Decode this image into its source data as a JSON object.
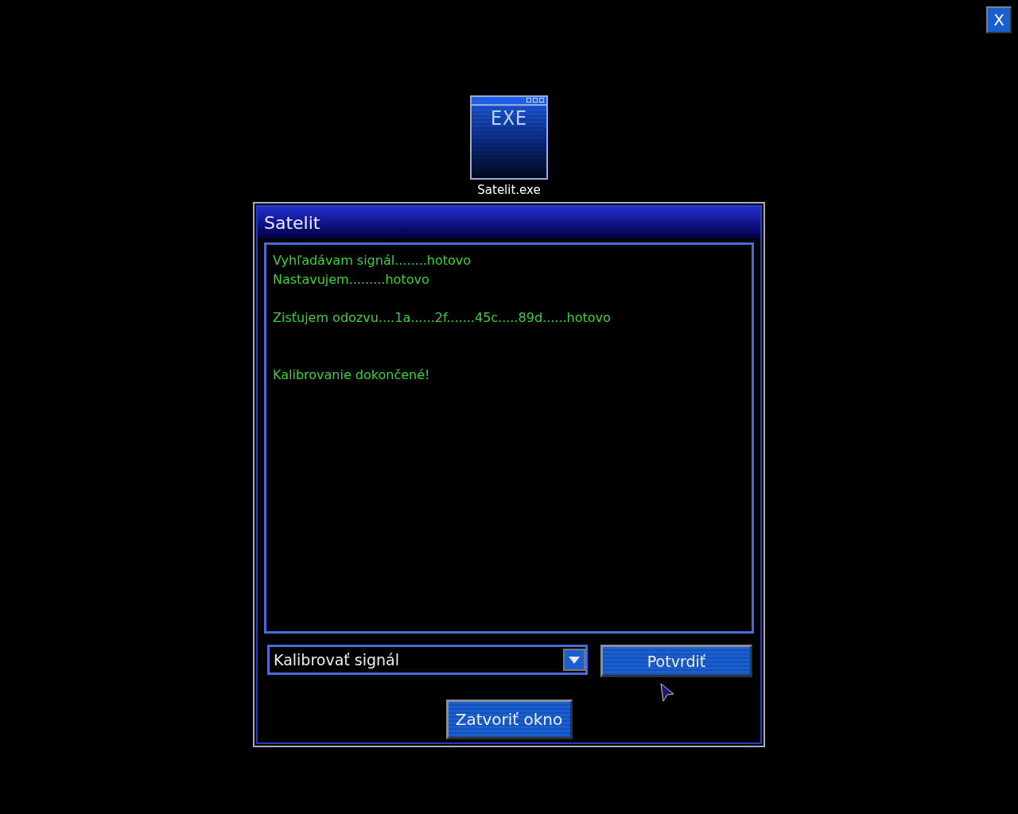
{
  "screen_close": {
    "label": "X"
  },
  "desktop_icon": {
    "badge": "EXE",
    "label": "Satelit.exe"
  },
  "window": {
    "title": "Satelit",
    "log": [
      {
        "text": "Vyhľadávam signál........hotovo",
        "kind": "next"
      },
      {
        "text": "Nastavujem.........hotovo",
        "kind": "next"
      },
      {
        "text": "Zisťujem odozvu....1a......2f.......45c.....89d......hotovo",
        "kind": "gap"
      },
      {
        "text": "Kalibrovanie dokončené!",
        "kind": "double_gap"
      }
    ],
    "dropdown": {
      "value": "Kalibrovať signál"
    },
    "confirm_button": "Potvrdiť",
    "close_button": "Zatvoriť okno"
  }
}
